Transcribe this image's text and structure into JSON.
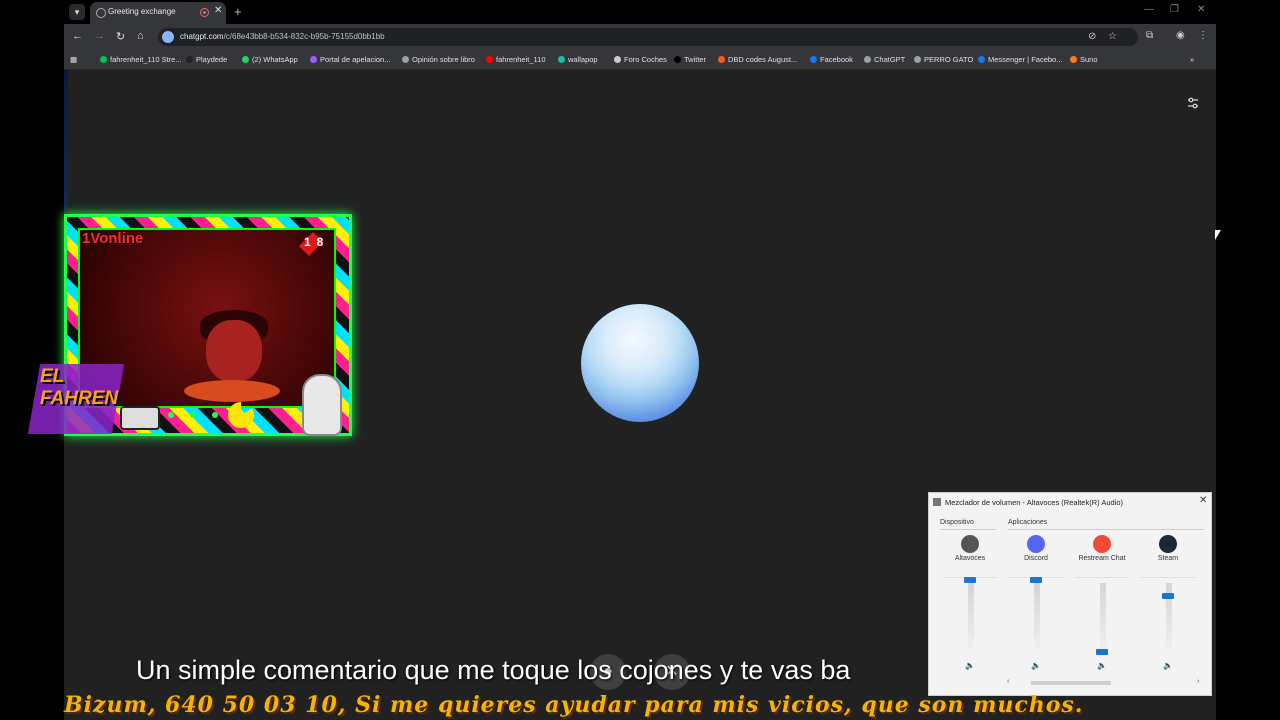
{
  "browser": {
    "tab_title": "Greeting exchange",
    "url_host": "chatgpt.com",
    "url_path": "/c/68e43bb8-b534-832c-b95b-75155d0bb1bb",
    "bookmarks": [
      {
        "label": "fahrenheit_110 Stre...",
        "color": "#00c853"
      },
      {
        "label": "Playdede",
        "color": "#222222"
      },
      {
        "label": "(2) WhatsApp",
        "color": "#25d366"
      },
      {
        "label": "Portal de apelacion...",
        "color": "#9c5cff"
      },
      {
        "label": "Opinión sobre libro",
        "color": "#9aa0a6"
      },
      {
        "label": "fahrenheit_110",
        "color": "#ff0000"
      },
      {
        "label": "wallapop",
        "color": "#13c1ac"
      },
      {
        "label": "Foro Coches",
        "color": "#cccccc"
      },
      {
        "label": "Twitter",
        "color": "#000000"
      },
      {
        "label": "DBD codes August...",
        "color": "#ff5722"
      },
      {
        "label": "Facebook",
        "color": "#1877f2"
      },
      {
        "label": "ChatGPT",
        "color": "#9aa0a6"
      },
      {
        "label": "PERRO GATO",
        "color": "#9aa0a6"
      },
      {
        "label": "Messenger | Facebo...",
        "color": "#1877f2"
      },
      {
        "label": "Suno",
        "color": "#ff7a18"
      }
    ]
  },
  "overlay": {
    "online_label": "1Vonline",
    "badge_number": "18",
    "logo_text": "EL\nFAHREN"
  },
  "mixer": {
    "title": "Mezclador de volumen - Altavoces (Realtek(R) Audio)",
    "device_section": "Dispositivo",
    "apps_section": "Aplicaciones",
    "apps": [
      {
        "label": "Altavoces",
        "icon": "speaker-device-icon",
        "color": "#555555",
        "level": 1.0
      },
      {
        "label": "Discord",
        "icon": "discord-icon",
        "color": "#5865f2",
        "level": 1.0
      },
      {
        "label": "Restream Chat",
        "icon": "restream-icon",
        "color": "#ef4b36",
        "level": 0.0
      },
      {
        "label": "Steam",
        "icon": "steam-icon",
        "color": "#1b2838",
        "level": 0.78
      }
    ]
  },
  "captions": {
    "subtitle": "Un simple comentario que me toque los cojones y te vas ba",
    "ticker": "Bizum, 640 50 03 10,  Si me quieres ayudar para mis vicios, que son muchos."
  }
}
